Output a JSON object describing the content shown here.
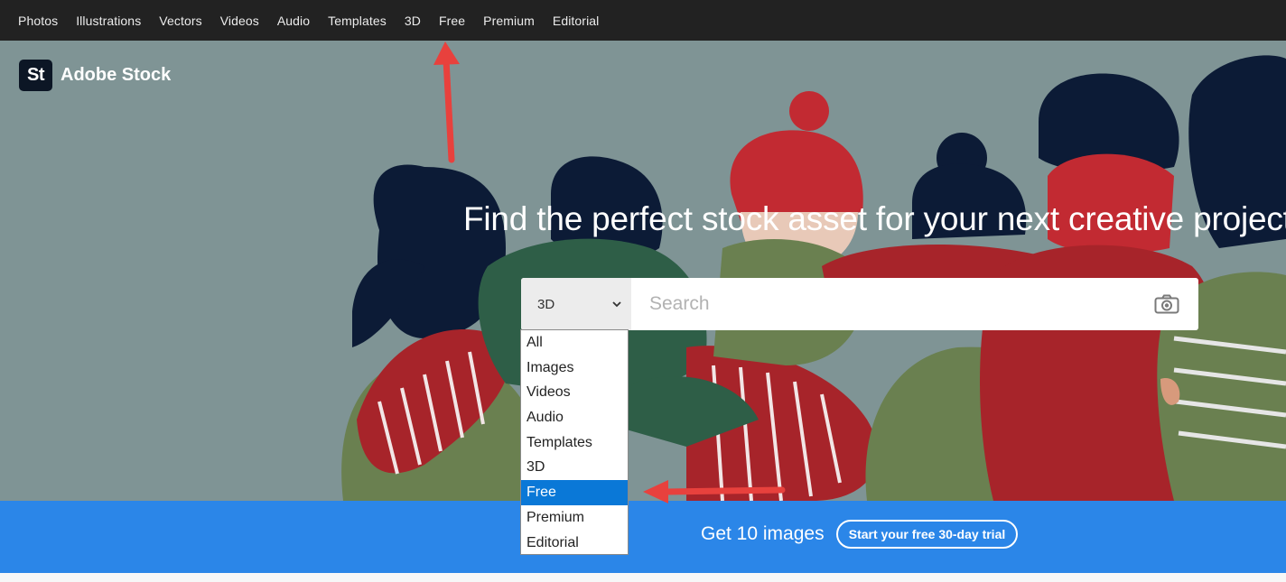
{
  "topnav": {
    "items": [
      "Photos",
      "Illustrations",
      "Vectors",
      "Videos",
      "Audio",
      "Templates",
      "3D",
      "Free",
      "Premium",
      "Editorial"
    ]
  },
  "brand": {
    "mark": "St",
    "name": "Adobe Stock"
  },
  "hero": {
    "headline": "Find the perfect stock asset for your next creative project"
  },
  "search": {
    "category_selected": "3D",
    "placeholder": "Search",
    "camera_icon": "camera-icon",
    "dropdown_icon": "chevron-down-icon"
  },
  "dropdown": {
    "options": [
      "All",
      "Images",
      "Videos",
      "Audio",
      "Templates",
      "3D",
      "Free",
      "Premium",
      "Editorial"
    ],
    "highlighted": "Free"
  },
  "promo": {
    "text": "Get 10 images",
    "button_label": "Start your free 30-day trial"
  },
  "colors": {
    "topnav_bg": "#222222",
    "hero_bg": "#7f9495",
    "promo_bg": "#2b86e8",
    "highlight": "#0a78d7",
    "annotation_arrow": "#e8413d"
  }
}
